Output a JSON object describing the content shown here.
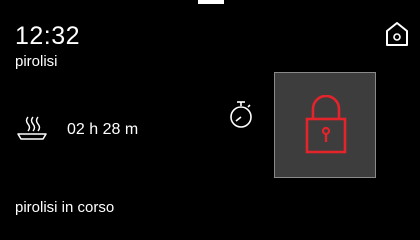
{
  "status_bar": {
    "time": "12:32",
    "mode": "pirolisi"
  },
  "cycle": {
    "duration": "02 h 28 m",
    "status": "pirolisi in corso"
  },
  "icons": {
    "home": "home-icon",
    "dish": "steaming-dish-icon",
    "timer": "stopwatch-icon",
    "lock": "padlock-icon"
  },
  "colors": {
    "background": "#000000",
    "text": "#ffffff",
    "lock_accent": "#e3242b",
    "tile_background": "#3d3d3d",
    "tile_border": "#8a8a8a"
  }
}
